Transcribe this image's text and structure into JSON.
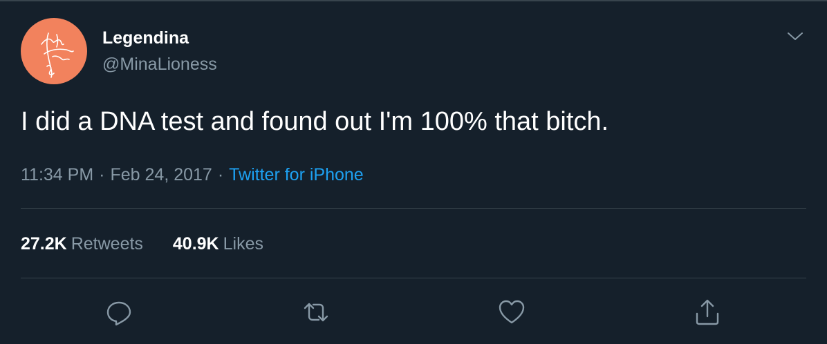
{
  "user": {
    "display_name": "Legendina",
    "handle": "@MinaLioness",
    "avatar_color": "#f2825d"
  },
  "tweet": {
    "text": "I did a DNA test and found out I'm 100% that bitch."
  },
  "meta": {
    "time": "11:34 PM",
    "separator": "·",
    "date": "Feb 24, 2017",
    "source": "Twitter for iPhone"
  },
  "stats": {
    "retweets": {
      "count": "27.2K",
      "label": "Retweets"
    },
    "likes": {
      "count": "40.9K",
      "label": "Likes"
    }
  },
  "actions": {
    "reply_icon": "reply-icon",
    "retweet_icon": "retweet-icon",
    "like_icon": "heart-icon",
    "share_icon": "share-icon"
  },
  "colors": {
    "background": "#15202b",
    "primary_text": "#ffffff",
    "secondary_text": "#8899a6",
    "accent": "#1da1f2",
    "divider": "#38444d"
  }
}
